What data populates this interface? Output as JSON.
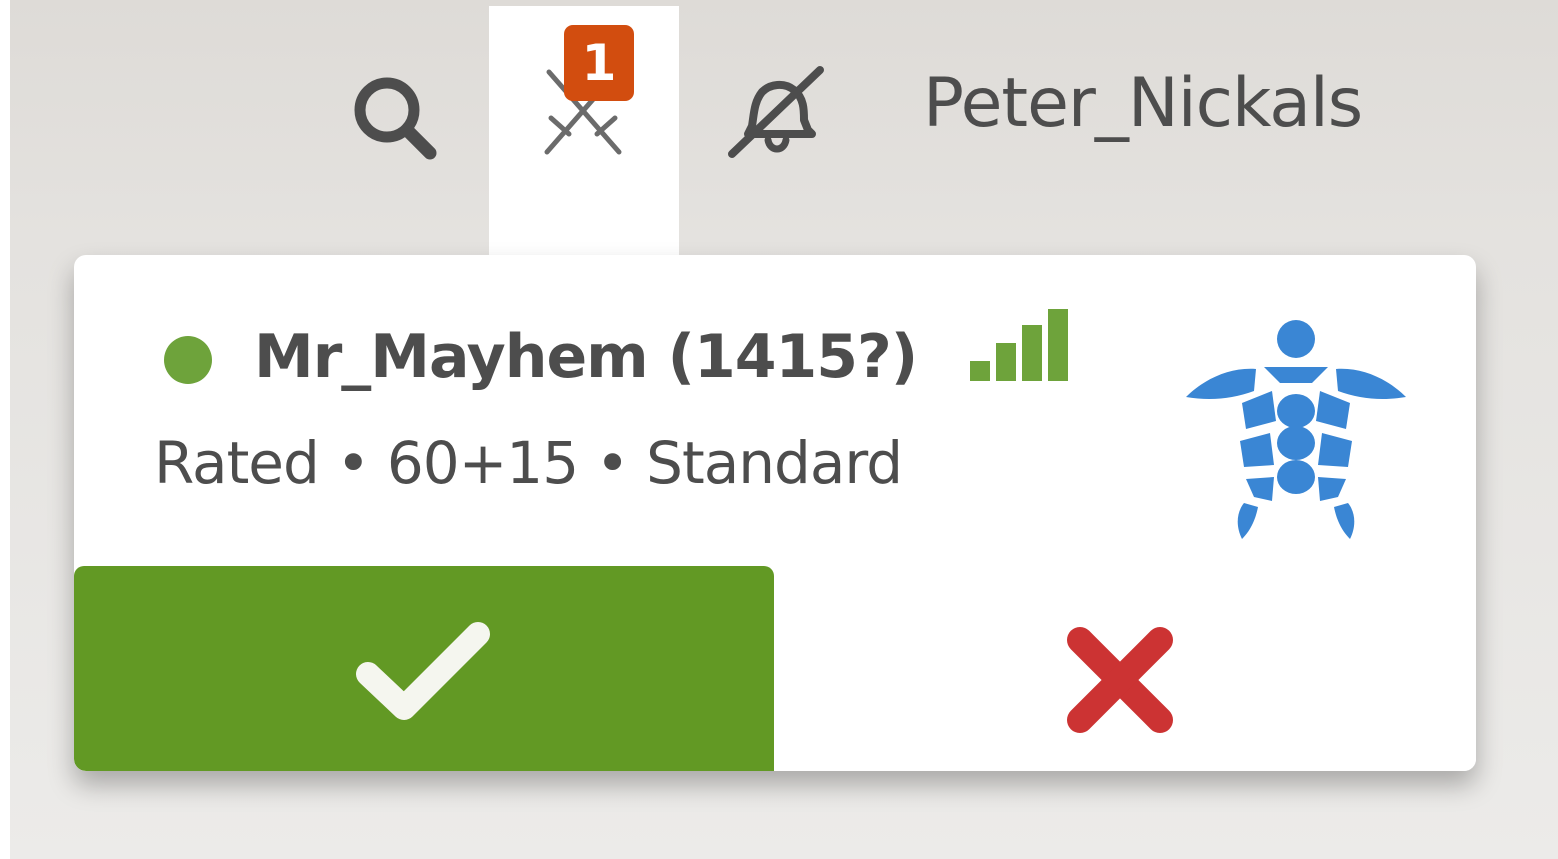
{
  "header": {
    "search_icon": "search-icon",
    "challenge_icon": "crossed-swords-icon",
    "challenge_count": "1",
    "notification_icon": "bell-muted-icon",
    "username": "Peter_Nickals"
  },
  "challenge": {
    "status": "online",
    "challenger": "Mr_Mayhem (1415?)",
    "connection_icon": "signal-bars-icon",
    "details": "Rated • 60+15 • Standard",
    "variant_icon": "turtle-icon",
    "accept_icon": "checkmark-icon",
    "decline_icon": "close-icon"
  },
  "colors": {
    "online": "#6ea33b",
    "badge": "#d24d0f",
    "accept": "#629924",
    "decline": "#cc3333",
    "turtle": "#3a86d4"
  }
}
